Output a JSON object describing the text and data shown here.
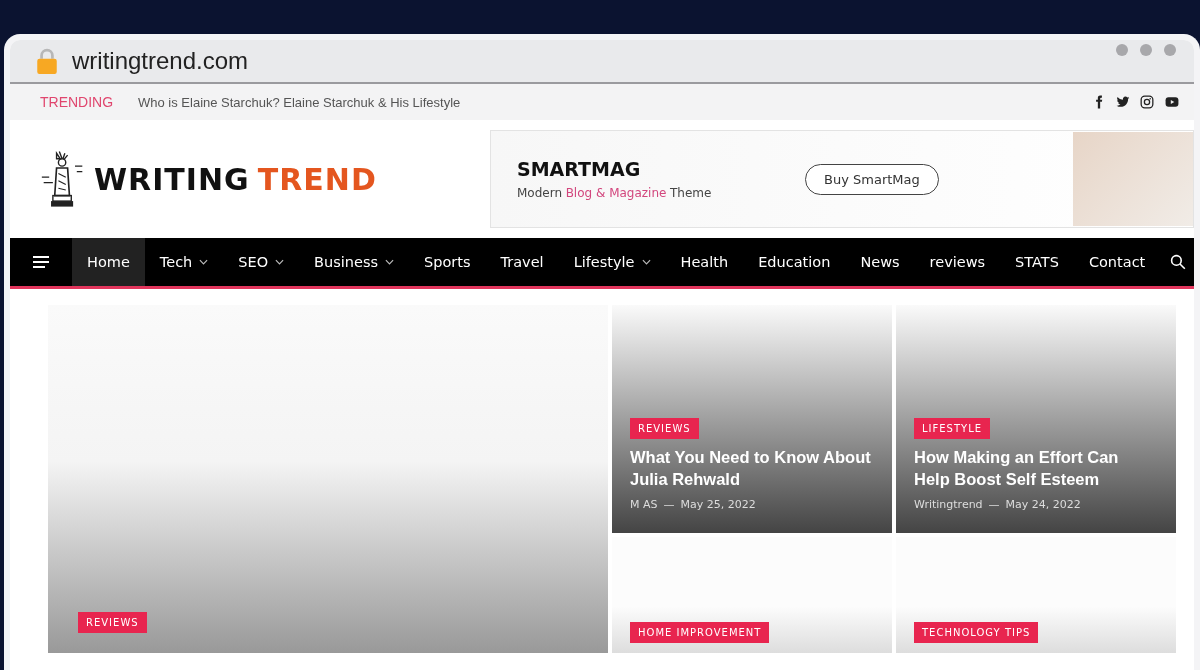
{
  "browser": {
    "url": "writingtrend.com"
  },
  "topbar": {
    "label": "TRENDING",
    "headline": "Who is Elaine Starchuk? Elaine Starchuk & His Lifestyle",
    "social": [
      {
        "kind": "facebook"
      },
      {
        "kind": "twitter"
      },
      {
        "kind": "instagram"
      },
      {
        "kind": "youtube"
      }
    ]
  },
  "logo": {
    "word_1": "WRITING",
    "word_2": "TREND"
  },
  "ad": {
    "brand": "SMARTMAG",
    "tagline": [
      {
        "text": "Modern",
        "highlight": false
      },
      {
        "text": "Blog & Magazine",
        "highlight": true
      },
      {
        "text": "Theme",
        "highlight": false
      }
    ],
    "button": "Buy SmartMag"
  },
  "nav": [
    {
      "label": "Home",
      "selected": true,
      "dropdown": false
    },
    {
      "label": "Tech",
      "selected": false,
      "dropdown": true
    },
    {
      "label": "SEO",
      "selected": false,
      "dropdown": true
    },
    {
      "label": "Business",
      "selected": false,
      "dropdown": true
    },
    {
      "label": "Sports",
      "selected": false,
      "dropdown": false
    },
    {
      "label": "Travel",
      "selected": false,
      "dropdown": false
    },
    {
      "label": "Lifestyle",
      "selected": false,
      "dropdown": true
    },
    {
      "label": "Health",
      "selected": false,
      "dropdown": false
    },
    {
      "label": "Education",
      "selected": false,
      "dropdown": false
    },
    {
      "label": "News",
      "selected": false,
      "dropdown": false
    },
    {
      "label": "reviews",
      "selected": false,
      "dropdown": false
    },
    {
      "label": "STATS",
      "selected": false,
      "dropdown": false
    },
    {
      "label": "Contact",
      "selected": false,
      "dropdown": false
    }
  ],
  "feature": {
    "tag": "REVIEWS"
  },
  "posts": [
    {
      "tag": "REVIEWS",
      "title": "What You Need to Know About Julia Rehwald",
      "author": "M AS",
      "separator": "—",
      "date": "May 25, 2022"
    },
    {
      "tag": "LIFESTYLE",
      "title": "How Making an Effort Can Help Boost Self Esteem",
      "author": "Writingtrend",
      "separator": "—",
      "date": "May 24, 2022"
    },
    {
      "tag": "HOME IMPROVEMENT"
    },
    {
      "tag": "TECHNOLOGY TIPS"
    }
  ]
}
